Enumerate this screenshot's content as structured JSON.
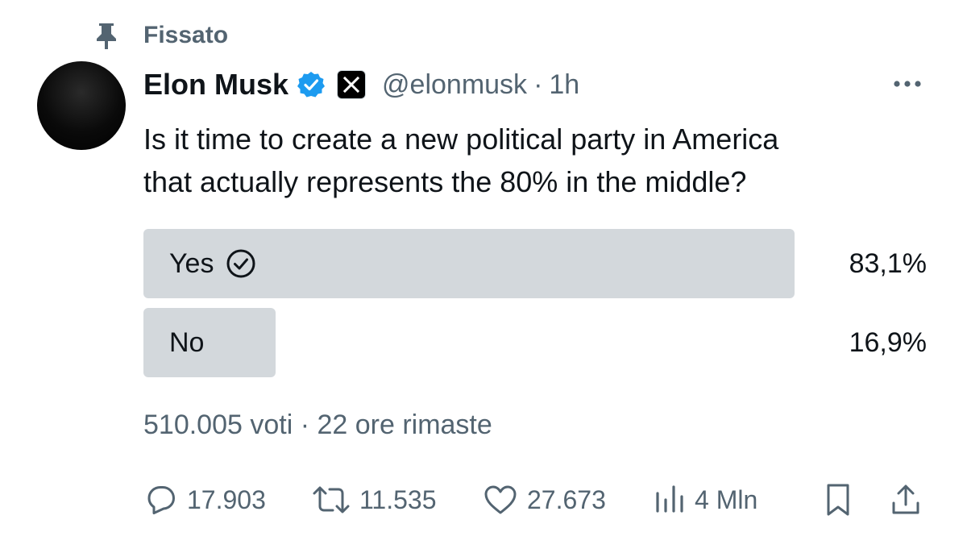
{
  "pinned": {
    "label": "Fissato"
  },
  "author": {
    "name": "Elon Musk",
    "handle": "@elonmusk",
    "separator": "·",
    "time": "1h"
  },
  "tweet": {
    "line1": "Is it time to create a new political party in America",
    "line2": "that actually represents the 80% in the middle?"
  },
  "poll": {
    "options": [
      {
        "label": "Yes",
        "percent": "83,1%",
        "value": 0.831,
        "selected": true
      },
      {
        "label": "No",
        "percent": "16,9%",
        "value": 0.169,
        "selected": false
      }
    ],
    "meta": "510.005 voti · 22 ore rimaste"
  },
  "actions": {
    "replies": "17.903",
    "reposts": "11.535",
    "likes": "27.673",
    "views": "4 Mln"
  },
  "colors": {
    "text": "#0f1419",
    "secondary": "#536471",
    "verified": "#1d9bf0",
    "poll_bar": "#d3d8dc"
  },
  "icons": [
    "pin-icon",
    "verified-icon",
    "x-logo-icon",
    "more-icon",
    "check-circle-icon",
    "reply-icon",
    "repost-icon",
    "like-icon",
    "views-icon",
    "bookmark-icon",
    "share-icon"
  ]
}
